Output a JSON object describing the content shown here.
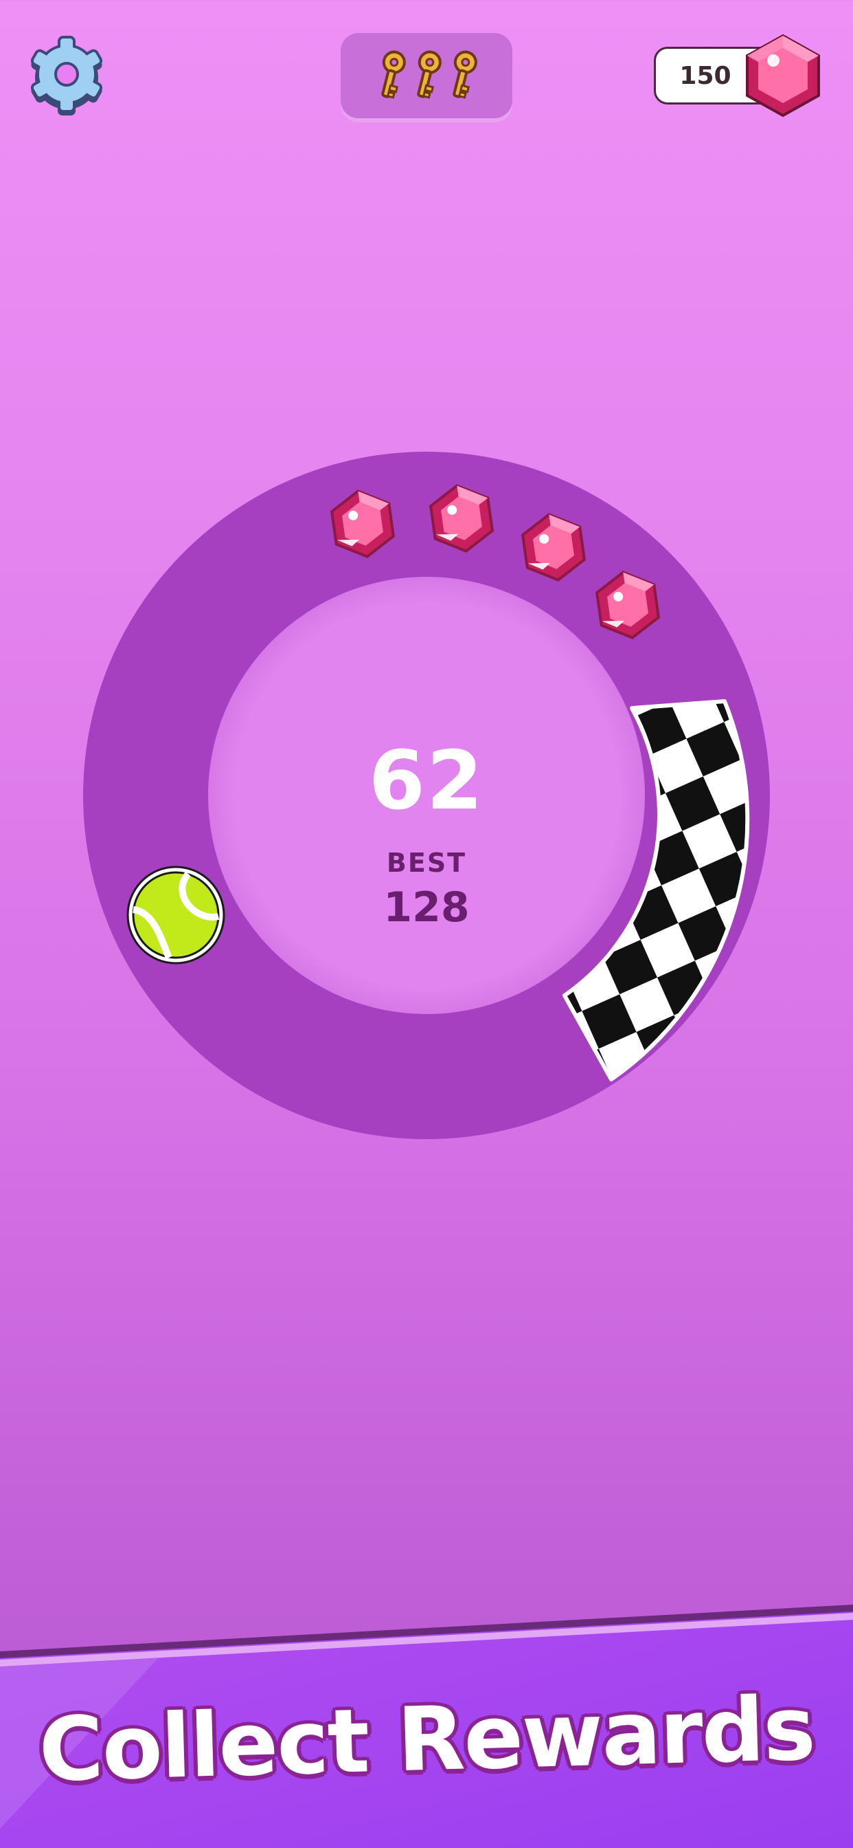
{
  "hud": {
    "settings_icon": "gear-icon",
    "keys_icon": "key-icon",
    "keys_collected": 3,
    "gems_icon": "pink-gem-icon",
    "gems_count": "150"
  },
  "game": {
    "score": "62",
    "best_label": "BEST",
    "best_value": "128",
    "ball_icon": "tennis-ball-icon",
    "finish_icon": "checkered-finish-icon",
    "gem_icon": "pink-gem-icon",
    "gems_on_track": 4
  },
  "banner": {
    "title": "Collect Rewards"
  },
  "colors": {
    "background_top": "#ee90f6",
    "ring_track": "#a840c2",
    "ring_center": "#e082ee",
    "gem": "#ef3f7e",
    "ball": "#c2ea1a",
    "banner": "#9a3ef0",
    "banner_outline": "#8a2394"
  }
}
